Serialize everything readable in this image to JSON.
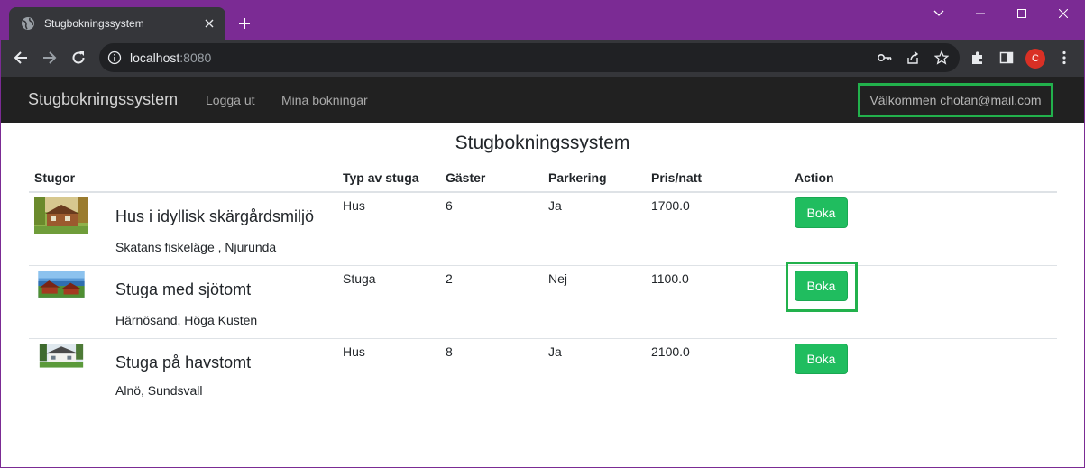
{
  "browser": {
    "tab_title": "Stugbokningssystem",
    "url_host": "localhost",
    "url_port": ":8080",
    "profile_initial": "C"
  },
  "navbar": {
    "brand": "Stugbokningssystem",
    "links": [
      "Logga ut",
      "Mina bokningar"
    ],
    "welcome": "Välkommen chotan@mail.com"
  },
  "main": {
    "title": "Stugbokningssystem",
    "columns": [
      "Stugor",
      "Typ av stuga",
      "Gäster",
      "Parkering",
      "Pris/natt",
      "Action"
    ],
    "rows": [
      {
        "name": "Hus i idyllisk skärgårdsmiljö",
        "location": "Skatans fiskeläge , Njurunda",
        "type": "Hus",
        "guests": "6",
        "parking": "Ja",
        "price": "1700.0",
        "action": "Boka",
        "image": "log-cabin"
      },
      {
        "name": "Stuga med sjötomt",
        "location": "Härnösand, Höga Kusten",
        "type": "Stuga",
        "guests": "2",
        "parking": "Nej",
        "price": "1100.0",
        "action": "Boka",
        "image": "lakeside-cabin"
      },
      {
        "name": "Stuga på havstomt",
        "location": "Alnö, Sundsvall",
        "type": "Hus",
        "guests": "8",
        "parking": "Ja",
        "price": "2100.0",
        "action": "Boka",
        "image": "white-house"
      }
    ]
  },
  "colors": {
    "accent_frame": "#7b2b94",
    "navbar_bg": "#212121",
    "button_green": "#20bd5f",
    "highlight_green": "#22b14c"
  }
}
